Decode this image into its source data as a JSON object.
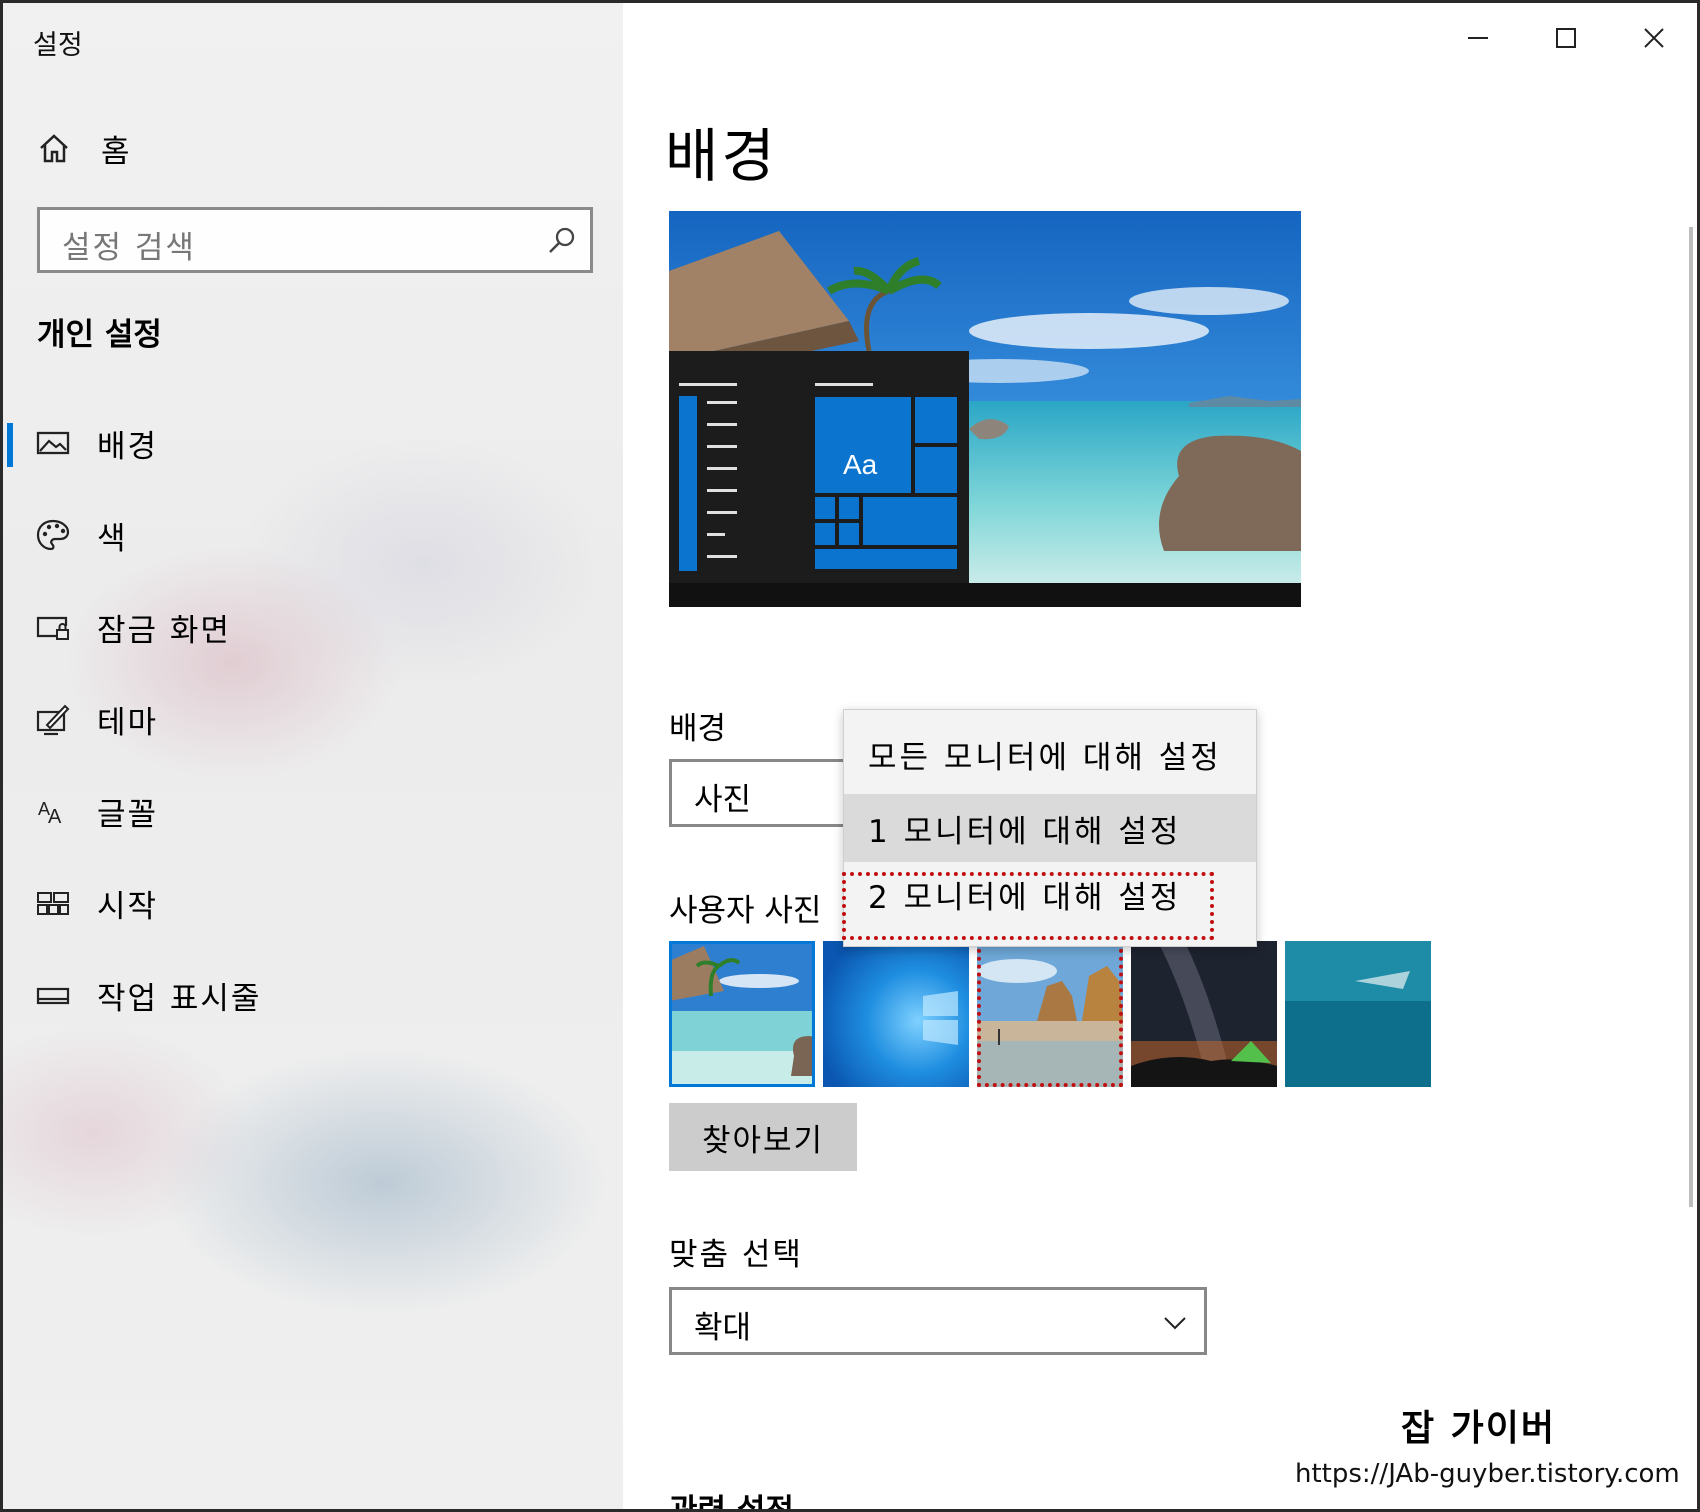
{
  "window": {
    "title": "설정",
    "controls": {
      "minimize": "minimize-icon",
      "maximize": "maximize-icon",
      "close": "close-icon"
    }
  },
  "sidebar": {
    "home_label": "홈",
    "search_placeholder": "설정 검색",
    "section_title": "개인 설정",
    "items": [
      {
        "label": "배경",
        "icon": "picture-icon",
        "active": true
      },
      {
        "label": "색",
        "icon": "palette-icon",
        "active": false
      },
      {
        "label": "잠금 화면",
        "icon": "lock-screen-icon",
        "active": false
      },
      {
        "label": "테마",
        "icon": "theme-icon",
        "active": false
      },
      {
        "label": "글꼴",
        "icon": "font-icon",
        "active": false
      },
      {
        "label": "시작",
        "icon": "start-icon",
        "active": false
      },
      {
        "label": "작업 표시줄",
        "icon": "taskbar-icon",
        "active": false
      }
    ]
  },
  "main": {
    "title": "배경",
    "preview": {
      "tile_label": "Aa"
    },
    "background_label": "배경",
    "background_value": "사진",
    "context_menu": {
      "options": [
        "모든 모니터에 대해 설정",
        "1 모니터에 대해 설정",
        "2 모니터에 대해 설정"
      ],
      "hovered_index": 1,
      "highlighted_index": 2
    },
    "user_photos_label": "사용자 사진",
    "photos": [
      {
        "name": "tropical-beach-hut",
        "selected": true
      },
      {
        "name": "windows-blue-logo",
        "selected": false
      },
      {
        "name": "beach-rock-arches",
        "selected": false,
        "highlighted": true
      },
      {
        "name": "night-sky-tent",
        "selected": false
      },
      {
        "name": "underwater-swimmer",
        "selected": false
      }
    ],
    "browse_label": "찾아보기",
    "fit_label": "맞춤 선택",
    "fit_value": "확대",
    "related_label": "관련 설정"
  },
  "watermark": {
    "title": "잡 가이버",
    "url": "https://JAb-guyber.tistory.com"
  },
  "colors": {
    "accent": "#0078d7",
    "highlight": "#c01010"
  }
}
